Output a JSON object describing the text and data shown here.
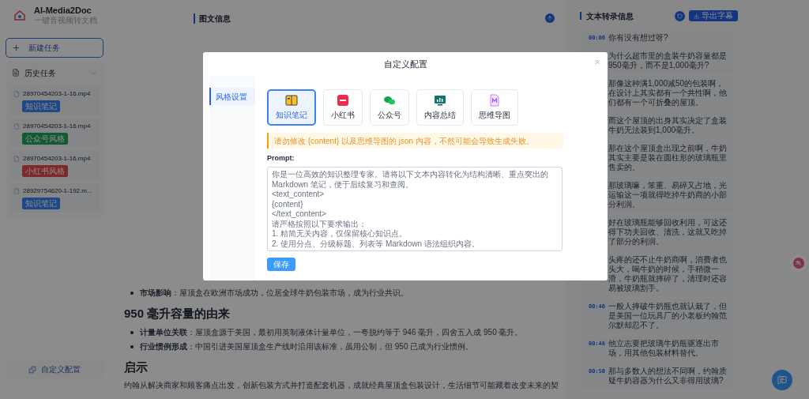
{
  "app": {
    "name": "AI-Media2Doc",
    "subtitle": "一键音视频转文档"
  },
  "new_task_button": "新建任务",
  "history": {
    "title": "历史任务",
    "expanded": true,
    "items": [
      {
        "file": "28970454203-1-16.mp4",
        "tag": "知识笔记",
        "color": "#204887"
      },
      {
        "file": "28970454203-1-16.mp4",
        "tag": "公众号风格",
        "color": "#135a32"
      },
      {
        "file": "28970454203-1-16.mp4",
        "tag": "小红书风格",
        "color": "#7e282a"
      },
      {
        "file": "28929754620-1-192.m...",
        "tag": "知识笔记",
        "color": "#204887"
      }
    ]
  },
  "custom_config_button": "自定义配置",
  "main": {
    "title": "图文信息",
    "blocks": [
      {
        "kind": "bullet",
        "label": "市场影响",
        "text": "：屋顶盒在欧洲市场成功，位居全球牛奶包装市场，成为行业共识。"
      },
      {
        "kind": "heading",
        "text": "950 毫升容量的由来"
      },
      {
        "kind": "bullet",
        "label": "计量单位关联",
        "text": "：屋顶盒源于美国，最初用英制液体计量单位，一夸脱约等于 946 毫升，四舍五入成 950 毫升。"
      },
      {
        "kind": "bullet",
        "label": "行业惯例形成",
        "text": "：中国引进美国屋顶盒生产线时沿用该标准，虽用公制，但 950 已成为行业惯例。"
      },
      {
        "kind": "heading",
        "text": "启示"
      },
      {
        "kind": "paragraph",
        "text": "约翰从解决商家和顾客痛点出发，创新包装方式并打造配套机器，成就经典屋顶盒包装设计，生活细节可能藏着改变未来的契"
      }
    ]
  },
  "transcript": {
    "title": "文本转录信息",
    "export_button": "导出字幕",
    "entries": [
      {
        "time": "00:00",
        "text": "你有没有想过呀?"
      },
      {
        "text": "为什么超市里的盒装牛奶容量都是950毫升，而不是1,000毫升?"
      },
      {
        "text": "那像这种满1,000减50的包装啊，在设计上其实都有一个共性啊，他们都有一个可折叠的屋顶。"
      },
      {
        "text": "而这个屋顶的出身其实决定了盒装牛奶无法装到1,000毫升。"
      },
      {
        "text": "那在这个屋顶盒出现之前啊，牛奶其实主要是装在圆柱形的玻璃瓶里售卖的。"
      },
      {
        "text": "那玻璃嘛，笨重、易碎又占地，光运输这一项就得吃掉牛奶商的小部分利润。"
      },
      {
        "text": "好在玻璃瓶能够回收利用，可这还得下功夫回收、清洗，这就又吃掉了部分的利润。"
      },
      {
        "text": "头疼的还不止牛奶商啊，消费者也头大，喝牛奶的时候，手稍微一滑，牛奶瓶就摔碎了，清理时还容易被玻璃割手。"
      },
      {
        "time": "00:40",
        "text": "一般人摔破牛奶瓶也就认栽了，但是美国一位玩具厂的小老板约翰范尔默却忍不了。"
      },
      {
        "time": "00:46",
        "text": "他立志要把玻璃牛奶瓶驱逐出市场，用其他包装材料替代。"
      },
      {
        "time": "00:50",
        "text": "那与多数人的想法不同啊，约翰质疑牛奶容器为什么又非得用玻璃?"
      }
    ]
  },
  "modal": {
    "title": "自定义配置",
    "nav": [
      {
        "label": "风格设置",
        "selected": true
      }
    ],
    "styles": [
      {
        "kind": "notes",
        "label": "知识笔记",
        "selected": true
      },
      {
        "kind": "redbook",
        "label": "小红书",
        "selected": false
      },
      {
        "kind": "chat",
        "label": "公众号",
        "selected": false
      },
      {
        "kind": "summary",
        "label": "内容总结",
        "selected": false
      },
      {
        "kind": "mindmap",
        "label": "思维导图",
        "selected": false
      }
    ],
    "warning": "请勿修改 {content} 以及思维导图的 json 内容，不然可能会导致生成失败。",
    "prompt_label": "Prompt:",
    "prompt_value": "你是一位高效的知识整理专家。请将以下文本内容转化为结构清晰、重点突出的 Markdown 笔记，便于后续复习和查阅。\n<text_content>\n{content}\n</text_content>\n请严格按照以下要求输出：\n1. 精简无关内容，仅保留核心知识点。\n2. 使用分点、分级标题、列表等 Markdown 语法组织内容。",
    "save_button": "保存"
  }
}
